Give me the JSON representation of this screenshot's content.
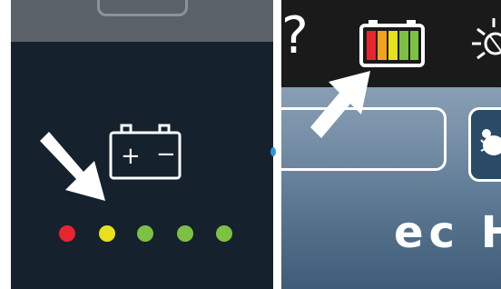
{
  "left_panel": {
    "battery_icon": "battery-plus-minus-icon",
    "battery_plus": "+",
    "battery_minus": "−",
    "charge_dots": [
      {
        "color": "#e8242f",
        "status": "red"
      },
      {
        "color": "#e6e11c",
        "status": "yellow"
      },
      {
        "color": "#7dc142",
        "status": "green"
      },
      {
        "color": "#7dc142",
        "status": "green"
      },
      {
        "color": "#7dc142",
        "status": "green"
      }
    ],
    "pointer_icon": "arrow-pointer-icon"
  },
  "right_panel": {
    "help_glyph": "?",
    "battery_icon": "battery-level-icon",
    "battery_bars": [
      "#e8242f",
      "#f2a21c",
      "#e6e11c",
      "#7dc142",
      "#7dc142"
    ],
    "light_icon": "light-bulb-icon",
    "pointer_icon": "arrow-pointer-icon",
    "mode_icon": "beetle-icon",
    "brand_text": "ec H"
  },
  "colors": {
    "left_background": "#15212c",
    "left_topbar": "#5b6267",
    "right_topbar": "#1a1a1a",
    "accent_blue": "#2a9bd4"
  }
}
